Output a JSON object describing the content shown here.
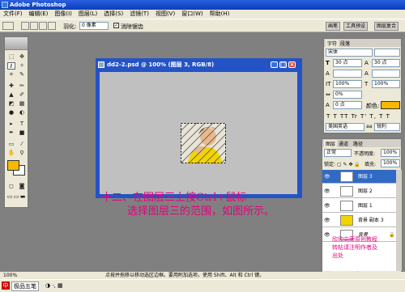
{
  "app": {
    "title": "Adobe Photoshop"
  },
  "menu": [
    "文件(F)",
    "编辑(E)",
    "图像(I)",
    "图层(L)",
    "选择(S)",
    "滤镜(T)",
    "视图(V)",
    "窗口(W)",
    "帮助(H)"
  ],
  "options": {
    "feather_label": "羽化:",
    "feather_value": "0 像素",
    "antialias_label": "消除锯齿"
  },
  "palette_tabs": [
    "画笔",
    "工具预设",
    "图层复合"
  ],
  "document": {
    "title": "dd2-2.psd @ 100% (图层 3, RGB/8)"
  },
  "caption": {
    "line1": "十二、在图层三上按Ctrl+鼠标",
    "line2": "选择图层三的范围，如图所示。"
  },
  "character_panel": {
    "tabs": [
      "字符",
      "段落"
    ],
    "font": "宋体",
    "size": "30 点",
    "leading": "30 点",
    "scale_v": "100%",
    "scale_h": "100%",
    "tracking": "0%",
    "baseline": "0 点",
    "color_label": "颜色:",
    "language": "美国英语",
    "antialias": "锐利",
    "color": "#f7b800"
  },
  "layers_panel": {
    "tabs": [
      "图层",
      "通道",
      "路径"
    ],
    "mode": "正常",
    "opacity_label": "不透明度:",
    "opacity": "100%",
    "fill_label": "填充:",
    "fill": "100%",
    "layers": [
      "图层 3",
      "图层 2",
      "图层 1",
      "背景 副本 3",
      "背景"
    ]
  },
  "watermark": {
    "line1": "欣欣向荣原创教程",
    "line2": "转帖请注明作者及",
    "line3": "出处"
  },
  "status": {
    "zoom": "100%",
    "hint": "点按并拖移以移动选区边框。要用附加选项，使用 Shift、Alt 和 Ctrl 键。"
  },
  "taskbar": {
    "ime": "极品五笔"
  },
  "colors": {
    "foreground": "#f7b800",
    "background": "#ffffff",
    "accent": "#2453c6"
  }
}
